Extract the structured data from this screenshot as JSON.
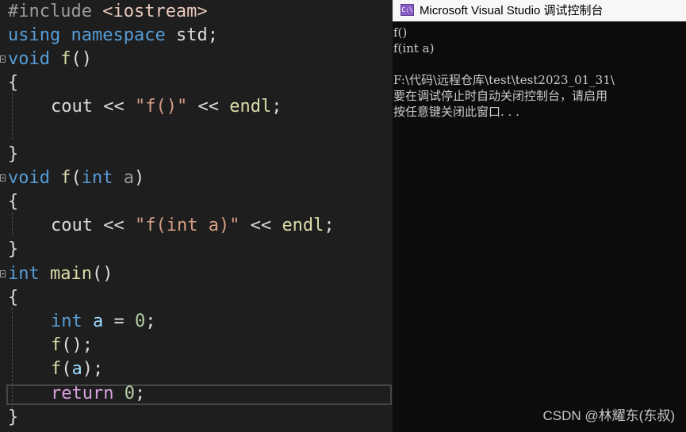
{
  "editor": {
    "lines": {
      "include": {
        "directive": "#include",
        "header": "<iostream>"
      },
      "using": {
        "kw1": "using",
        "kw2": "namespace",
        "ns": "std;"
      },
      "f1_sig": {
        "type": "void",
        "name": "f",
        "parens": "()"
      },
      "f1_open": "{",
      "f1_body": {
        "obj": "cout",
        "op1": "<<",
        "str": "\"f()\"",
        "op2": "<<",
        "endl": "endl",
        "semi": ";"
      },
      "f1_close": "}",
      "f2_sig": {
        "type": "void",
        "name": "f",
        "open": "(",
        "ptype": "int",
        "pname": "a",
        "close": ")"
      },
      "f2_open": "{",
      "f2_body": {
        "obj": "cout",
        "op1": "<<",
        "str": "\"f(int a)\"",
        "op2": "<<",
        "endl": "endl",
        "semi": ";"
      },
      "f2_close": "}",
      "main_sig": {
        "type": "int",
        "name": "main",
        "parens": "()"
      },
      "main_open": "{",
      "decl": {
        "type": "int",
        "var": "a",
        "assign": "=",
        "value": "0",
        "semi": ";"
      },
      "call1": {
        "fn": "f",
        "rest": "();"
      },
      "call2": {
        "fn": "f",
        "open": "(",
        "arg": "a",
        "close": ");"
      },
      "ret": {
        "kw": "return",
        "value": "0",
        "semi": ";"
      },
      "main_close": "}"
    }
  },
  "console": {
    "title": "Microsoft Visual Studio 调试控制台",
    "icon_text": "C:\\",
    "lines": [
      "f()",
      "f(int a)",
      "",
      "F:\\代码\\远程仓库\\test\\test2023_01_31\\",
      "要在调试停止时自动关闭控制台，请启用",
      "按任意键关闭此窗口. . ."
    ]
  },
  "watermark": "CSDN @林耀东(东叔)",
  "colors": {
    "editor_bg": "#1e1e1e",
    "console_bg": "#0c0c0c",
    "keyword": "#569cd6",
    "control_keyword": "#d8a0df",
    "function": "#dcdcaa",
    "string": "#d69d85",
    "number": "#b5cea8",
    "local_variable": "#9cdcfe"
  }
}
